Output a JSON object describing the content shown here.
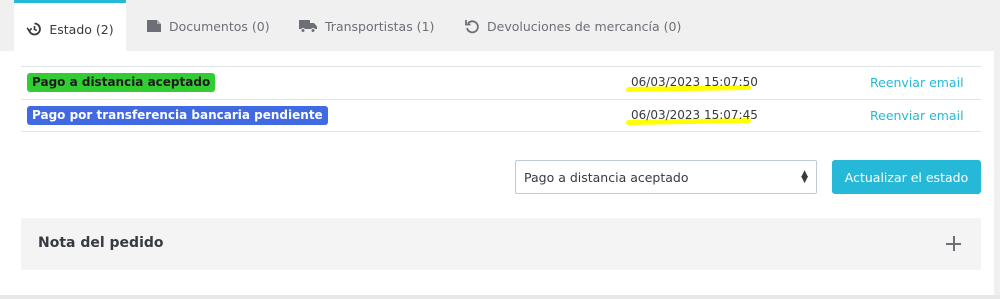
{
  "tabs": [
    {
      "label": "Estado (2)",
      "icon": "history-icon",
      "active": true
    },
    {
      "label": "Documentos (0)",
      "icon": "document-icon"
    },
    {
      "label": "Transportistas (1)",
      "icon": "truck-icon"
    },
    {
      "label": "Devoluciones de mercancía (0)",
      "icon": "return-icon"
    }
  ],
  "history": [
    {
      "status": "Pago a distancia aceptado",
      "status_color": "#32cd32",
      "date": "06/03/2023 15:07:50",
      "action": "Reenviar email"
    },
    {
      "status": "Pago por transferencia bancaria pendiente",
      "status_color": "#4169e1",
      "date": "06/03/2023 15:07:45",
      "action": "Reenviar email"
    }
  ],
  "status_select": {
    "selected": "Pago a distancia aceptado"
  },
  "update_button": {
    "label": "Actualizar el estado"
  },
  "note": {
    "title": "Nota del pedido"
  },
  "colors": {
    "accent": "#25b9d7",
    "highlight": "#ffff00"
  }
}
